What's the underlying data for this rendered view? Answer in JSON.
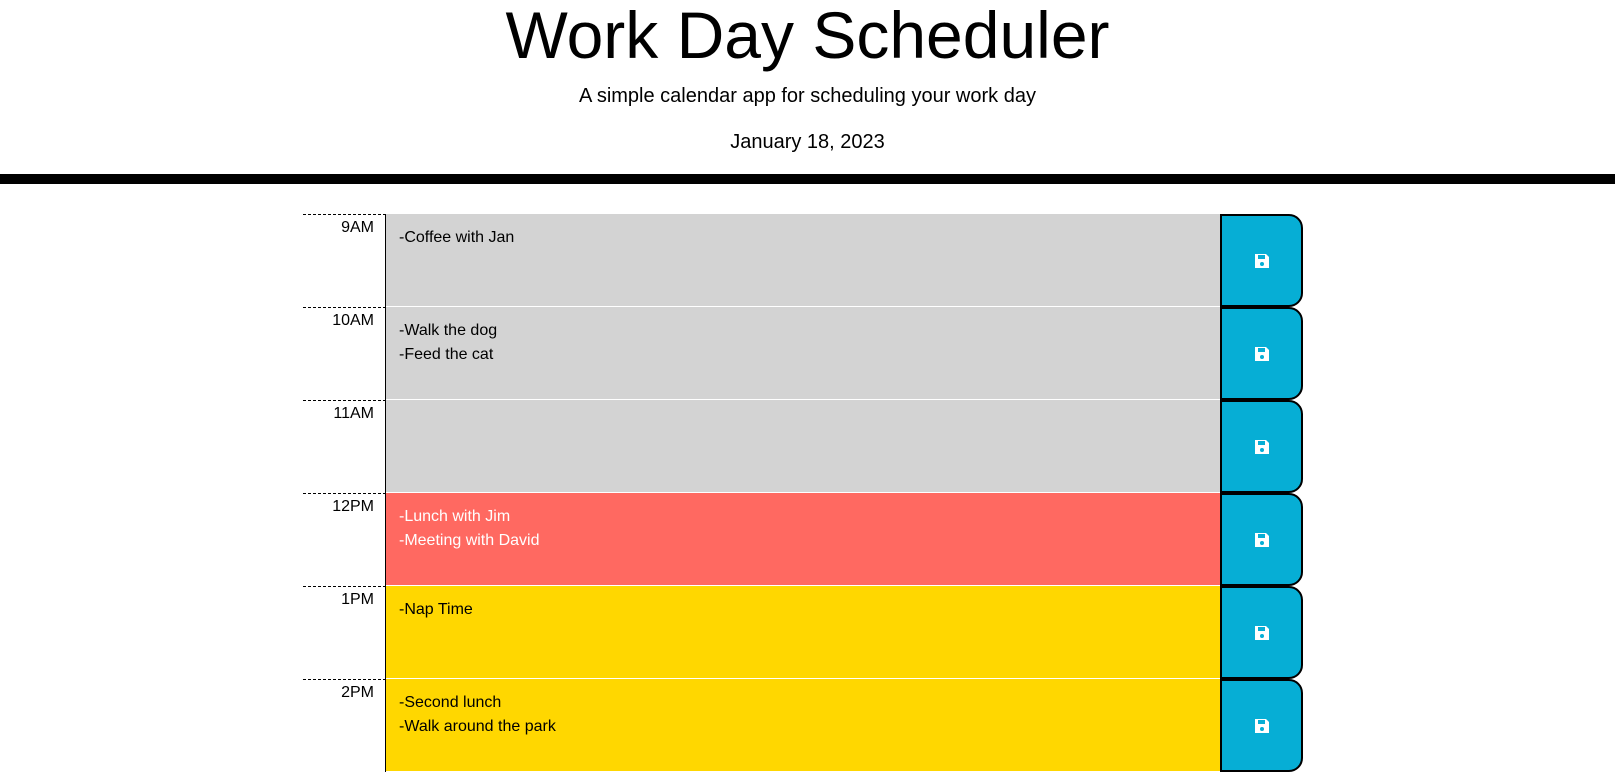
{
  "header": {
    "title": "Work Day Scheduler",
    "subtitle": "A simple calendar app for scheduling your work day",
    "date": "January 18, 2023"
  },
  "colors": {
    "past": "#d3d3d3",
    "present": "#ff6961",
    "future": "#ffd700",
    "save_button": "#06aed5"
  },
  "rows": [
    {
      "hour": "9AM",
      "text": "-Coffee with Jan",
      "state": "past"
    },
    {
      "hour": "10AM",
      "text": "-Walk the dog\n-Feed the cat",
      "state": "past"
    },
    {
      "hour": "11AM",
      "text": "",
      "state": "past"
    },
    {
      "hour": "12PM",
      "text": "-Lunch with Jim\n-Meeting with David",
      "state": "present"
    },
    {
      "hour": "1PM",
      "text": "-Nap Time",
      "state": "future"
    },
    {
      "hour": "2PM",
      "text": "-Second lunch\n-Walk around the park",
      "state": "future"
    }
  ],
  "save_icon": "floppy-disk-icon"
}
